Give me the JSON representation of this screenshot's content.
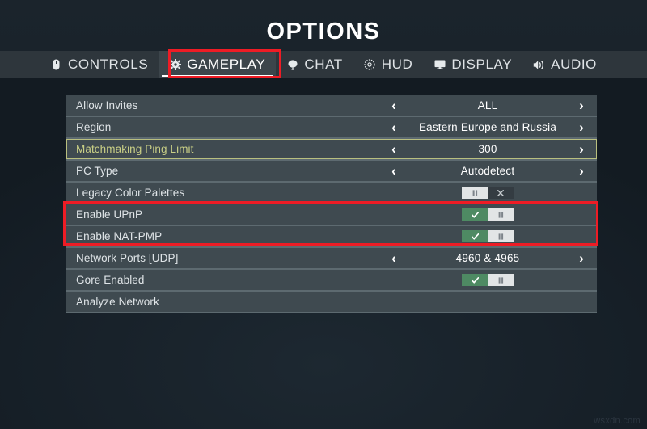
{
  "header": {
    "title": "OPTIONS"
  },
  "tabs": [
    {
      "label": "CONTROLS",
      "icon": "mouse-icon",
      "selected": false
    },
    {
      "label": "GAMEPLAY",
      "icon": "gear-icon",
      "selected": true
    },
    {
      "label": "CHAT",
      "icon": "balloon-icon",
      "selected": false
    },
    {
      "label": "HUD",
      "icon": "target-icon",
      "selected": false
    },
    {
      "label": "DISPLAY",
      "icon": "monitor-icon",
      "selected": false
    },
    {
      "label": "AUDIO",
      "icon": "speaker-icon",
      "selected": false
    }
  ],
  "options": {
    "rows": [
      {
        "label": "Allow Invites",
        "type": "spinner",
        "value": "ALL",
        "highlighted": false,
        "annotated": false
      },
      {
        "label": "Region",
        "type": "spinner",
        "value": "Eastern Europe and Russia",
        "highlighted": false,
        "annotated": false
      },
      {
        "label": "Matchmaking Ping Limit",
        "type": "spinner",
        "value": "300",
        "highlighted": true,
        "annotated": false
      },
      {
        "label": "PC Type",
        "type": "spinner",
        "value": "Autodetect",
        "highlighted": false,
        "annotated": false
      },
      {
        "label": "Legacy Color Palettes",
        "type": "toggle",
        "state": "off",
        "highlighted": false,
        "annotated": false
      },
      {
        "label": "Enable UPnP",
        "type": "toggle",
        "state": "on",
        "highlighted": false,
        "annotated": true
      },
      {
        "label": "Enable NAT-PMP",
        "type": "toggle",
        "state": "on",
        "highlighted": false,
        "annotated": true
      },
      {
        "label": "Network Ports [UDP]",
        "type": "spinner",
        "value": "4960 & 4965",
        "highlighted": false,
        "annotated": false
      },
      {
        "label": "Gore Enabled",
        "type": "toggle",
        "state": "on",
        "highlighted": false,
        "annotated": false
      },
      {
        "label": "Analyze Network",
        "type": "action",
        "value": "",
        "highlighted": false,
        "annotated": false
      }
    ],
    "arrow_left": "‹",
    "arrow_right": "›"
  },
  "annotations": {
    "tab_highlight_color": "#ee1c25",
    "rows_highlight_color": "#ee1c25",
    "focused_row_color": "#c9cf86",
    "toggle_on_color": "#4e8a63"
  },
  "watermark": {
    "text": "wsxdn.com"
  }
}
